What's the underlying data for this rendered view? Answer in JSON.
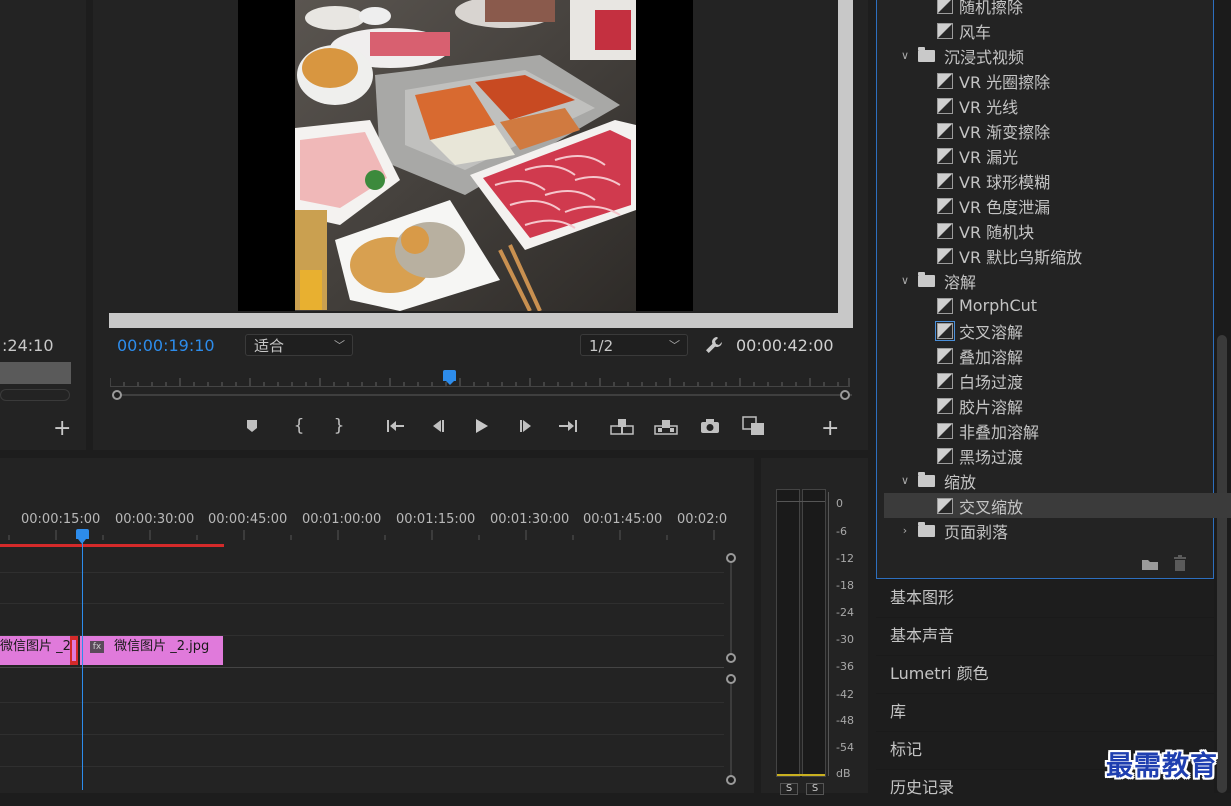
{
  "source_panel": {
    "timecode": ":24:10"
  },
  "program": {
    "current_time": "00:00:19:10",
    "fit_option": "适合",
    "resolution": "1/2",
    "duration": "00:00:42:00"
  },
  "timeline": {
    "ruler_labels": [
      "00:00:15:00",
      "00:00:30:00",
      "00:00:45:00",
      "00:01:00:00",
      "00:01:15:00",
      "00:01:30:00",
      "00:01:45:00",
      "00:02:0"
    ],
    "clip_left": "微信图片 _2",
    "clip_right": "微信图片 _2.jpg",
    "clip_fx": "fx"
  },
  "audio_meter": {
    "labels": [
      "0",
      "-6",
      "-12",
      "-18",
      "-24",
      "-30",
      "-36",
      "-42",
      "-48",
      "-54",
      "dB"
    ],
    "solo_labels": [
      "S",
      "S"
    ]
  },
  "effects_tree": [
    {
      "type": "effect",
      "label": "随机擦除",
      "indent": 1
    },
    {
      "type": "effect",
      "label": "风车",
      "indent": 1
    },
    {
      "type": "folder",
      "label": "沉浸式视频",
      "expanded": true
    },
    {
      "type": "effect",
      "label": "VR 光圈擦除",
      "indent": 1
    },
    {
      "type": "effect",
      "label": "VR 光线",
      "indent": 1
    },
    {
      "type": "effect",
      "label": "VR 渐变擦除",
      "indent": 1
    },
    {
      "type": "effect",
      "label": "VR 漏光",
      "indent": 1
    },
    {
      "type": "effect",
      "label": "VR 球形模糊",
      "indent": 1
    },
    {
      "type": "effect",
      "label": "VR 色度泄漏",
      "indent": 1
    },
    {
      "type": "effect",
      "label": "VR 随机块",
      "indent": 1
    },
    {
      "type": "effect",
      "label": "VR 默比乌斯缩放",
      "indent": 1
    },
    {
      "type": "folder",
      "label": "溶解",
      "expanded": true
    },
    {
      "type": "effect",
      "label": "MorphCut",
      "indent": 1
    },
    {
      "type": "effect",
      "label": "交叉溶解",
      "indent": 1,
      "highlight": true
    },
    {
      "type": "effect",
      "label": "叠加溶解",
      "indent": 1
    },
    {
      "type": "effect",
      "label": "白场过渡",
      "indent": 1
    },
    {
      "type": "effect",
      "label": "胶片溶解",
      "indent": 1
    },
    {
      "type": "effect",
      "label": "非叠加溶解",
      "indent": 1
    },
    {
      "type": "effect",
      "label": "黑场过渡",
      "indent": 1
    },
    {
      "type": "folder",
      "label": "缩放",
      "expanded": true
    },
    {
      "type": "effect",
      "label": "交叉缩放",
      "indent": 1,
      "selected": true
    },
    {
      "type": "folder",
      "label": "页面剥落",
      "expanded": false
    }
  ],
  "side_panels": [
    "基本图形",
    "基本声音",
    "Lumetri 颜色",
    "库",
    "标记",
    "历史记录"
  ],
  "watermark": "最需教育"
}
